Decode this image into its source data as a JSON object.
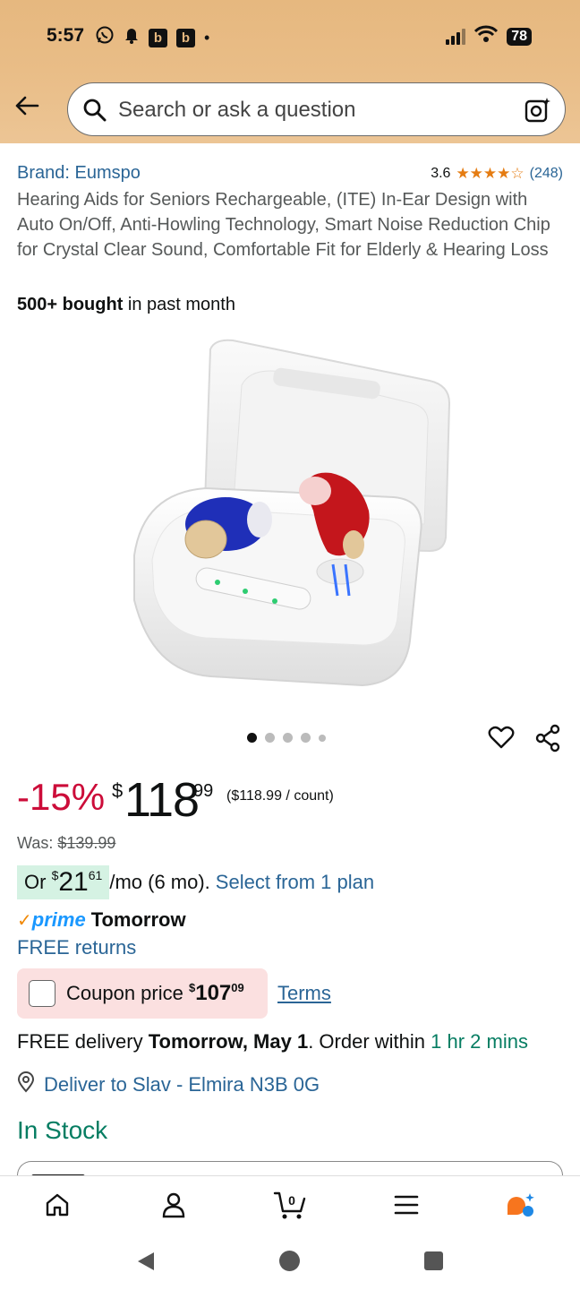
{
  "status_bar": {
    "time": "5:57",
    "notification_icons": [
      "whatsapp-icon",
      "bell-icon",
      "b-app-icon",
      "b-app-icon",
      "dot"
    ],
    "battery": "78"
  },
  "search": {
    "placeholder": "Search or ask a question"
  },
  "product": {
    "brand": "Brand: Eumspo",
    "rating": "3.6",
    "stars": "★★★★☆",
    "review_count": "(248)",
    "title": "Hearing Aids for Seniors Rechargeable, (ITE) In-Ear Design with Auto On/Off, Anti-Howling Technology, Smart Noise Reduction Chip for Crystal Clear Sound, Comfortable Fit for Elderly & Hearing Loss",
    "bought_bold": "500+ bought",
    "bought_rest": " in past month",
    "image_alt": "White charging case with blue and red in-ear hearing aids"
  },
  "gallery": {
    "image_count": 5,
    "active_index": 0
  },
  "pricing": {
    "discount": "-15%",
    "currency": "$",
    "price_whole": "118",
    "price_fraction": "99",
    "unit_price": "($118.99 / count)",
    "was_label": "Was: ",
    "was_price": "$139.99",
    "installment_prefix": "Or ",
    "installment_currency": "$",
    "installment_whole": "21",
    "installment_fraction": "61",
    "installment_suffix": "/mo (6 mo).",
    "select_plan": "Select from 1 plan"
  },
  "prime": {
    "check": "✓",
    "prime_word": "prime",
    "delivery_day": "Tomorrow",
    "free_returns": "FREE returns"
  },
  "coupon": {
    "label": "Coupon price ",
    "currency": "$",
    "whole": "107",
    "fraction": "09",
    "terms": "Terms"
  },
  "delivery": {
    "prefix": "FREE delivery ",
    "date": "Tomorrow, May 1",
    "middle": ". Order within ",
    "countdown": "1 hr 2 mins",
    "deliver_to": "Deliver to Slav - Elmira N3B 0G",
    "stock": "In Stock"
  },
  "bottom_nav": [
    "home-icon",
    "account-icon",
    "cart-icon",
    "menu-icon",
    "rufus-icon"
  ],
  "cart_count": "0",
  "colors": {
    "header_bg": "#e9bd87",
    "link": "#2a6596",
    "discount": "#cc0c39",
    "in_stock": "#067d62",
    "prime_blue": "#1a98ff",
    "coupon_bg": "#fbe0e0",
    "installment_bg": "#d5f2e3"
  }
}
